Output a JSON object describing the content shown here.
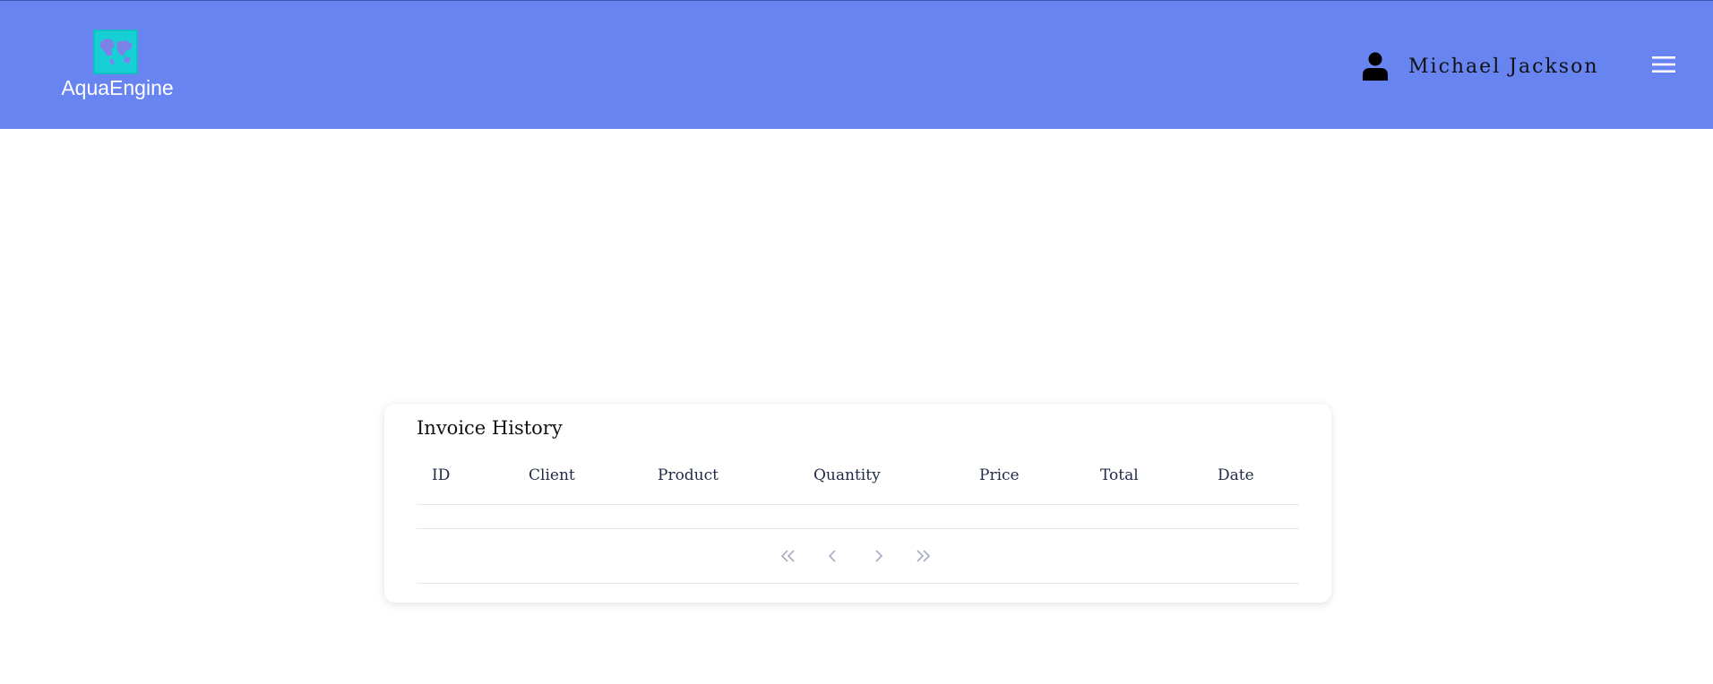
{
  "app": {
    "name": "AquaEngine",
    "header_color": "#6784f1",
    "logo_bg": "#17d0d6"
  },
  "user": {
    "name": "Michael Jackson"
  },
  "invoice_history": {
    "title": "Invoice History",
    "columns": [
      "ID",
      "Client",
      "Product",
      "Quantity",
      "Price",
      "Total",
      "Date"
    ],
    "rows": []
  },
  "pagination": {
    "buttons": [
      "first-page-icon",
      "previous-page-icon",
      "next-page-icon",
      "last-page-icon"
    ]
  }
}
